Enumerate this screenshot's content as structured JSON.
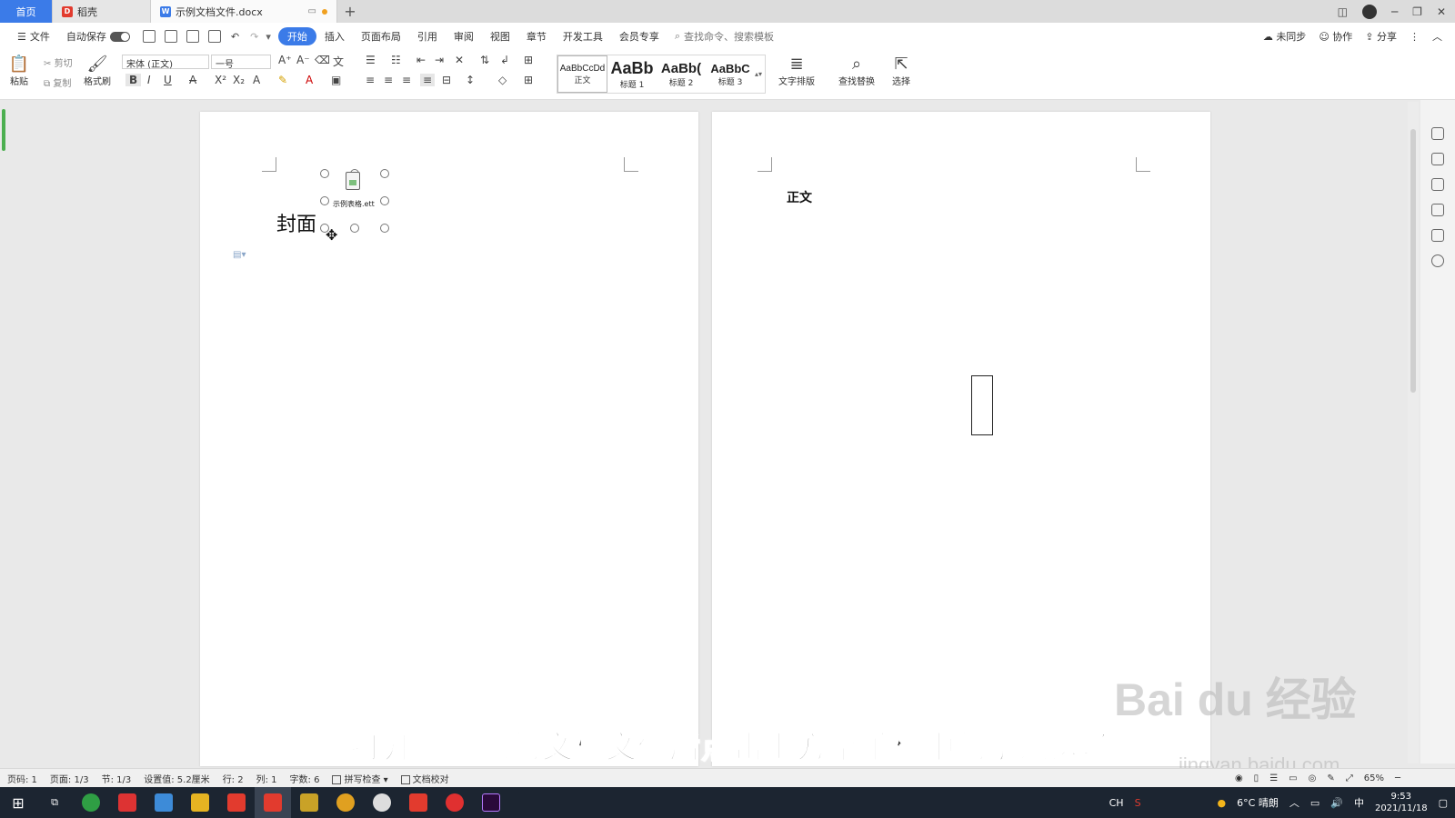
{
  "tabs": {
    "home": "首页",
    "daoke": "稻壳",
    "doc": "示例文档文件.docx",
    "new": "+"
  },
  "menu": {
    "file": "文件",
    "autosave": "自动保存",
    "items": [
      "开始",
      "插入",
      "页面布局",
      "引用",
      "审阅",
      "视图",
      "章节",
      "开发工具",
      "会员专享"
    ],
    "search_placeholder": "查找命令、搜索模板",
    "unsync": "未同步",
    "collab": "协作",
    "share": "分享"
  },
  "ribbon": {
    "paste": "粘贴",
    "cut": "剪切",
    "copy": "复制",
    "format_painter": "格式刷",
    "font_name": "宋体 (正文)",
    "font_size": "一号",
    "styles": [
      {
        "preview": "AaBbCcDd",
        "label": "正文"
      },
      {
        "preview": "AaBb",
        "label": "标题 1"
      },
      {
        "preview": "AaBb(",
        "label": "标题 2"
      },
      {
        "preview": "AaBbC",
        "label": "标题 3"
      }
    ],
    "text_layout": "文字排版",
    "find_replace": "查找替换",
    "select": "选择"
  },
  "page1": {
    "title": "封面",
    "attachment_name": "示例表格.ett"
  },
  "page2": {
    "body": "正文"
  },
  "subtitle": "打开要编辑的文档文件后点击上方菜单栏中的引用选项",
  "watermark": {
    "brand": "Bai  du 经验",
    "url": "jingyan.baidu.com"
  },
  "status": {
    "page_num": "页码: 1",
    "pages": "页面: 1/3",
    "section": "节: 1/3",
    "setting": "设置值: 5.2厘米",
    "row": "行: 2",
    "col": "列: 1",
    "words": "字数: 6",
    "spell": "拼写检查",
    "proof": "文档校对",
    "zoom": "65%"
  },
  "taskbar": {
    "ime": "CH",
    "weather": "6°C 晴朗",
    "lang": "中",
    "time": "9:53",
    "date": "2021/11/18"
  },
  "colors": {
    "accent": "#3b7be8",
    "wps_red": "#e23b2e",
    "taskbar": "#1c2531"
  }
}
